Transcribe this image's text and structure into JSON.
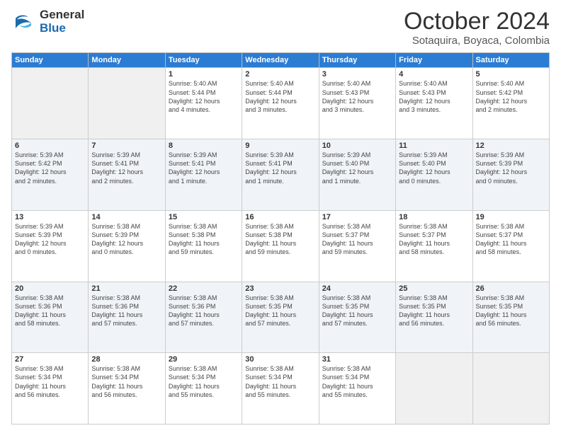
{
  "header": {
    "logo_general": "General",
    "logo_blue": "Blue",
    "month": "October 2024",
    "location": "Sotaquira, Boyaca, Colombia"
  },
  "weekdays": [
    "Sunday",
    "Monday",
    "Tuesday",
    "Wednesday",
    "Thursday",
    "Friday",
    "Saturday"
  ],
  "weeks": [
    [
      {
        "day": "",
        "info": ""
      },
      {
        "day": "",
        "info": ""
      },
      {
        "day": "1",
        "info": "Sunrise: 5:40 AM\nSunset: 5:44 PM\nDaylight: 12 hours\nand 4 minutes."
      },
      {
        "day": "2",
        "info": "Sunrise: 5:40 AM\nSunset: 5:44 PM\nDaylight: 12 hours\nand 3 minutes."
      },
      {
        "day": "3",
        "info": "Sunrise: 5:40 AM\nSunset: 5:43 PM\nDaylight: 12 hours\nand 3 minutes."
      },
      {
        "day": "4",
        "info": "Sunrise: 5:40 AM\nSunset: 5:43 PM\nDaylight: 12 hours\nand 3 minutes."
      },
      {
        "day": "5",
        "info": "Sunrise: 5:40 AM\nSunset: 5:42 PM\nDaylight: 12 hours\nand 2 minutes."
      }
    ],
    [
      {
        "day": "6",
        "info": "Sunrise: 5:39 AM\nSunset: 5:42 PM\nDaylight: 12 hours\nand 2 minutes."
      },
      {
        "day": "7",
        "info": "Sunrise: 5:39 AM\nSunset: 5:41 PM\nDaylight: 12 hours\nand 2 minutes."
      },
      {
        "day": "8",
        "info": "Sunrise: 5:39 AM\nSunset: 5:41 PM\nDaylight: 12 hours\nand 1 minute."
      },
      {
        "day": "9",
        "info": "Sunrise: 5:39 AM\nSunset: 5:41 PM\nDaylight: 12 hours\nand 1 minute."
      },
      {
        "day": "10",
        "info": "Sunrise: 5:39 AM\nSunset: 5:40 PM\nDaylight: 12 hours\nand 1 minute."
      },
      {
        "day": "11",
        "info": "Sunrise: 5:39 AM\nSunset: 5:40 PM\nDaylight: 12 hours\nand 0 minutes."
      },
      {
        "day": "12",
        "info": "Sunrise: 5:39 AM\nSunset: 5:39 PM\nDaylight: 12 hours\nand 0 minutes."
      }
    ],
    [
      {
        "day": "13",
        "info": "Sunrise: 5:39 AM\nSunset: 5:39 PM\nDaylight: 12 hours\nand 0 minutes."
      },
      {
        "day": "14",
        "info": "Sunrise: 5:38 AM\nSunset: 5:39 PM\nDaylight: 12 hours\nand 0 minutes."
      },
      {
        "day": "15",
        "info": "Sunrise: 5:38 AM\nSunset: 5:38 PM\nDaylight: 11 hours\nand 59 minutes."
      },
      {
        "day": "16",
        "info": "Sunrise: 5:38 AM\nSunset: 5:38 PM\nDaylight: 11 hours\nand 59 minutes."
      },
      {
        "day": "17",
        "info": "Sunrise: 5:38 AM\nSunset: 5:37 PM\nDaylight: 11 hours\nand 59 minutes."
      },
      {
        "day": "18",
        "info": "Sunrise: 5:38 AM\nSunset: 5:37 PM\nDaylight: 11 hours\nand 58 minutes."
      },
      {
        "day": "19",
        "info": "Sunrise: 5:38 AM\nSunset: 5:37 PM\nDaylight: 11 hours\nand 58 minutes."
      }
    ],
    [
      {
        "day": "20",
        "info": "Sunrise: 5:38 AM\nSunset: 5:36 PM\nDaylight: 11 hours\nand 58 minutes."
      },
      {
        "day": "21",
        "info": "Sunrise: 5:38 AM\nSunset: 5:36 PM\nDaylight: 11 hours\nand 57 minutes."
      },
      {
        "day": "22",
        "info": "Sunrise: 5:38 AM\nSunset: 5:36 PM\nDaylight: 11 hours\nand 57 minutes."
      },
      {
        "day": "23",
        "info": "Sunrise: 5:38 AM\nSunset: 5:35 PM\nDaylight: 11 hours\nand 57 minutes."
      },
      {
        "day": "24",
        "info": "Sunrise: 5:38 AM\nSunset: 5:35 PM\nDaylight: 11 hours\nand 57 minutes."
      },
      {
        "day": "25",
        "info": "Sunrise: 5:38 AM\nSunset: 5:35 PM\nDaylight: 11 hours\nand 56 minutes."
      },
      {
        "day": "26",
        "info": "Sunrise: 5:38 AM\nSunset: 5:35 PM\nDaylight: 11 hours\nand 56 minutes."
      }
    ],
    [
      {
        "day": "27",
        "info": "Sunrise: 5:38 AM\nSunset: 5:34 PM\nDaylight: 11 hours\nand 56 minutes."
      },
      {
        "day": "28",
        "info": "Sunrise: 5:38 AM\nSunset: 5:34 PM\nDaylight: 11 hours\nand 56 minutes."
      },
      {
        "day": "29",
        "info": "Sunrise: 5:38 AM\nSunset: 5:34 PM\nDaylight: 11 hours\nand 55 minutes."
      },
      {
        "day": "30",
        "info": "Sunrise: 5:38 AM\nSunset: 5:34 PM\nDaylight: 11 hours\nand 55 minutes."
      },
      {
        "day": "31",
        "info": "Sunrise: 5:38 AM\nSunset: 5:34 PM\nDaylight: 11 hours\nand 55 minutes."
      },
      {
        "day": "",
        "info": ""
      },
      {
        "day": "",
        "info": ""
      }
    ]
  ]
}
